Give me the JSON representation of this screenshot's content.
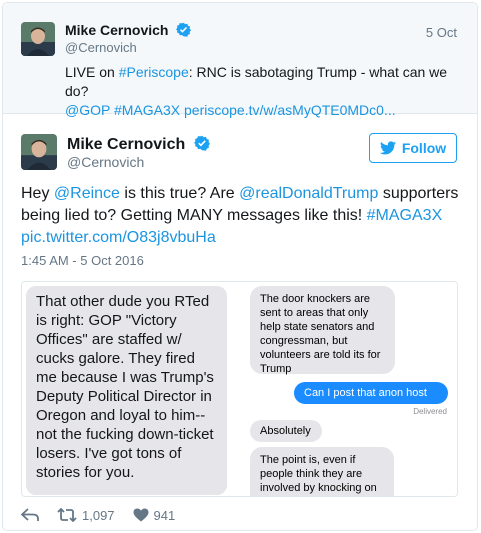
{
  "quoted_tweet": {
    "author_name": "Mike Cernovich",
    "author_handle": "@Cernovich",
    "date": "5 Oct",
    "text_prefix": "LIVE on ",
    "hashtag_periscope": "#Periscope",
    "text_middle": ": RNC is sabotaging Trump - what can we do?",
    "mention_gop": "@GOP",
    "hashtag_maga": "#MAGA3X",
    "link": "periscope.tv/w/asMyQTE0MDc0..."
  },
  "main_tweet": {
    "author_name": "Mike Cernovich",
    "author_handle": "@Cernovich",
    "follow_label": "Follow",
    "text_1": "Hey ",
    "mention_reince": "@Reince",
    "text_2": " is this true? Are ",
    "mention_trump": "@realDonaldTrump",
    "text_3": " supporters being lied to? Getting MANY messages like this! ",
    "hashtag": "#MAGA3X",
    "pic_link": "pic.twitter.com/O83j8vbuHa",
    "timestamp": "1:45 AM - 5 Oct 2016"
  },
  "media": {
    "left_message": "That other dude you RTed is right: GOP \"Victory Offices\" are staffed w/ cucks galore. They fired me because I was Trump's Deputy Political Director in Oregon and loyal to him--not the fucking down-ticket losers. I've got tons of stories for you.",
    "msg_1": "The door knockers are sent to areas that only help state senators and congressman, but volunteers are told its for Trump",
    "msg_2": "Can I post that anon host",
    "delivered": "Delivered",
    "msg_3": "Absolutely",
    "msg_4": "The point is, even if people think they are involved by knocking on doors for Trump, they're"
  },
  "actions": {
    "retweets": "1,097",
    "likes": "941"
  },
  "colors": {
    "link": "#1b95e0",
    "verified": "#1da1f2",
    "imessage_blue": "#1a8cff"
  },
  "icons": [
    "verified-badge-icon",
    "twitter-bird-icon",
    "reply-icon",
    "retweet-icon",
    "heart-icon"
  ]
}
